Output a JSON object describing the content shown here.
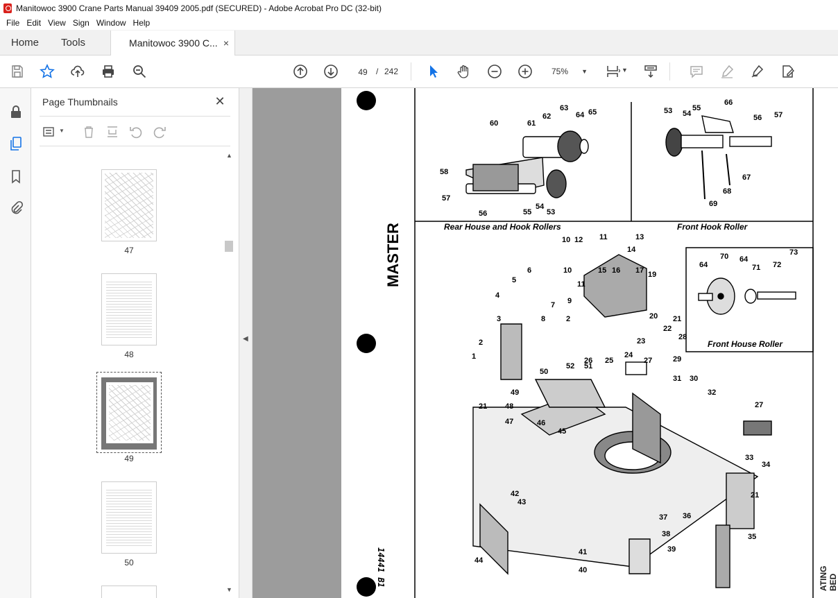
{
  "window": {
    "title": "Manitowoc 3900 Crane Parts Manual 39409 2005.pdf (SECURED) - Adobe Acrobat Pro DC (32-bit)"
  },
  "menu": [
    "File",
    "Edit",
    "View",
    "Sign",
    "Window",
    "Help"
  ],
  "tabs": {
    "home": "Home",
    "tools": "Tools",
    "document": "Manitowoc 3900 C...",
    "close": "×"
  },
  "toolbar": {
    "page_current": "49",
    "page_sep": "/",
    "page_total": "242",
    "zoom": "75%"
  },
  "thumbnails_panel": {
    "title": "Page Thumbnails",
    "pages": [
      "47",
      "48",
      "49",
      "50"
    ],
    "selected_page": "49"
  },
  "document_page": {
    "side_text": "MASTER",
    "handwritten": "14441 B1",
    "edge_text": "ATING BED",
    "section_labels": [
      "Rear  House and  Hook  Rollers",
      "Front  Hook  Roller",
      "Front  House  Roller"
    ],
    "callouts": {
      "rear_house_hook": [
        "60",
        "61",
        "62",
        "63",
        "64",
        "65",
        "58",
        "57",
        "56",
        "55",
        "54",
        "53"
      ],
      "front_hook": [
        "53",
        "54",
        "55",
        "66",
        "56",
        "57",
        "67",
        "68",
        "69"
      ],
      "front_house": [
        "64",
        "70",
        "64",
        "71",
        "72",
        "73"
      ],
      "main": [
        "10",
        "12",
        "11",
        "13",
        "14",
        "6",
        "5",
        "10",
        "11",
        "15",
        "16",
        "17",
        "19",
        "4",
        "9",
        "3",
        "7",
        "8",
        "2",
        "20",
        "21",
        "22",
        "28",
        "23",
        "2",
        "1",
        "24",
        "25",
        "26",
        "27",
        "29",
        "51",
        "52",
        "50",
        "31",
        "30",
        "49",
        "32",
        "48",
        "21",
        "47",
        "46",
        "45",
        "27",
        "33",
        "34",
        "43",
        "42",
        "21",
        "37",
        "36",
        "38",
        "35",
        "41",
        "39",
        "40",
        "44"
      ]
    }
  },
  "colors": {
    "accent_blue": "#1473e6",
    "acrobat_red": "#d9211c",
    "viewer_bg": "#9c9c9c"
  }
}
